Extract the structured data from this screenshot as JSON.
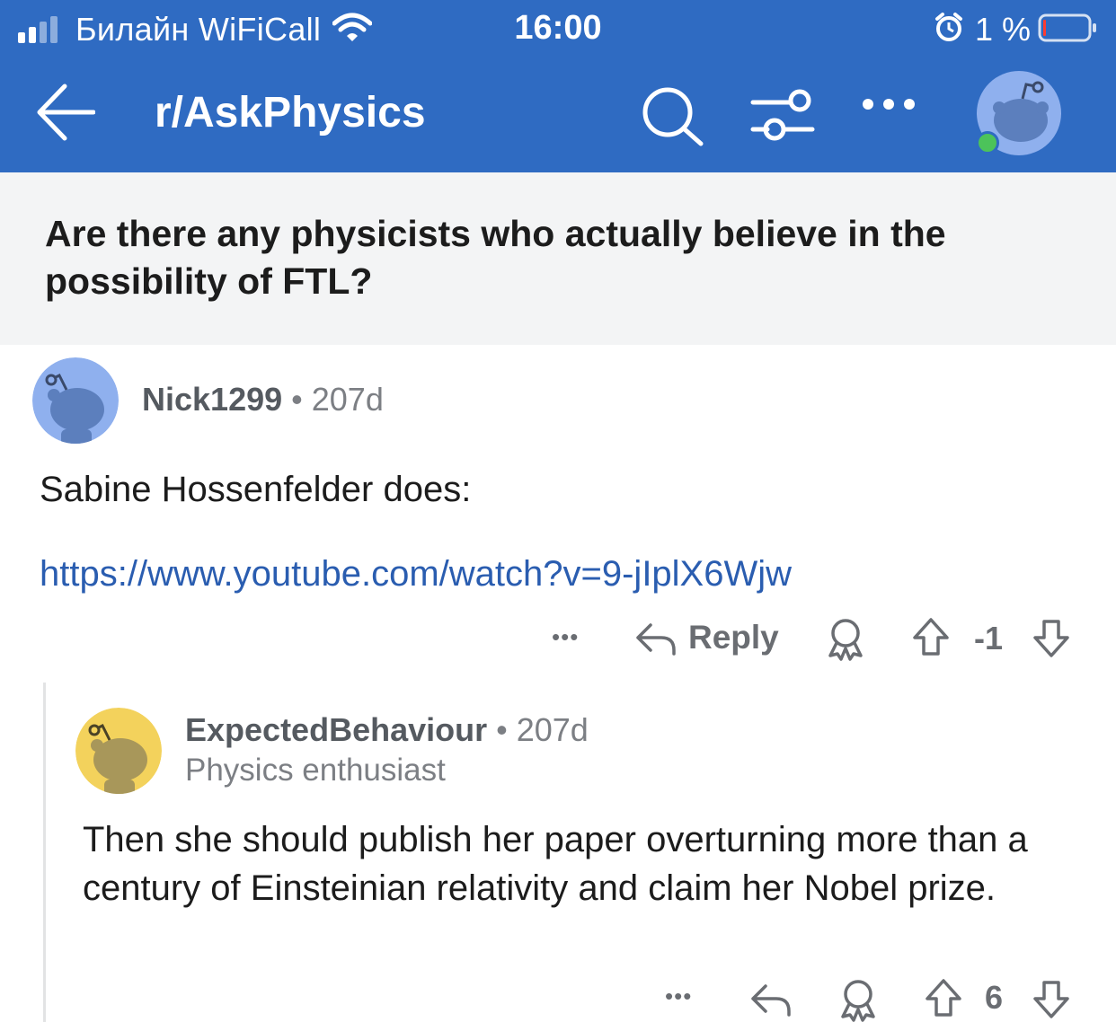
{
  "status_bar": {
    "carrier": "Билайн WiFiCall",
    "time": "16:00",
    "battery": "1 %"
  },
  "nav": {
    "title": "r/AskPhysics",
    "icons": [
      "back-arrow-icon",
      "search-icon",
      "filter-icon",
      "more-icon",
      "avatar"
    ]
  },
  "post": {
    "title": "Are there any physicists who actually believe in the possibility of FTL?"
  },
  "comments": [
    {
      "user": "Nick1299",
      "dot": "•",
      "age": "207d",
      "body_text": "Sabine Hossenfelder does:",
      "link": "https://www.youtube.com/watch?v=9-jIplX6Wjw",
      "actions": {
        "more": "•••",
        "reply": "Reply",
        "score": "-1"
      },
      "avatar_color": "#8fb0ee"
    },
    {
      "user": "ExpectedBehaviour",
      "dot": "•",
      "age": "207d",
      "flair": "Physics enthusiast",
      "body_text": "Then she should publish her paper overturning more than a century of Einsteinian relativity and claim her Nobel prize.",
      "actions": {
        "more": "•••",
        "score": "6"
      },
      "avatar_color": "#f3d25c"
    }
  ],
  "colors": {
    "header_bg": "#2f6bc2",
    "link": "#2a5db0",
    "online_dot": "#4cc35a"
  }
}
